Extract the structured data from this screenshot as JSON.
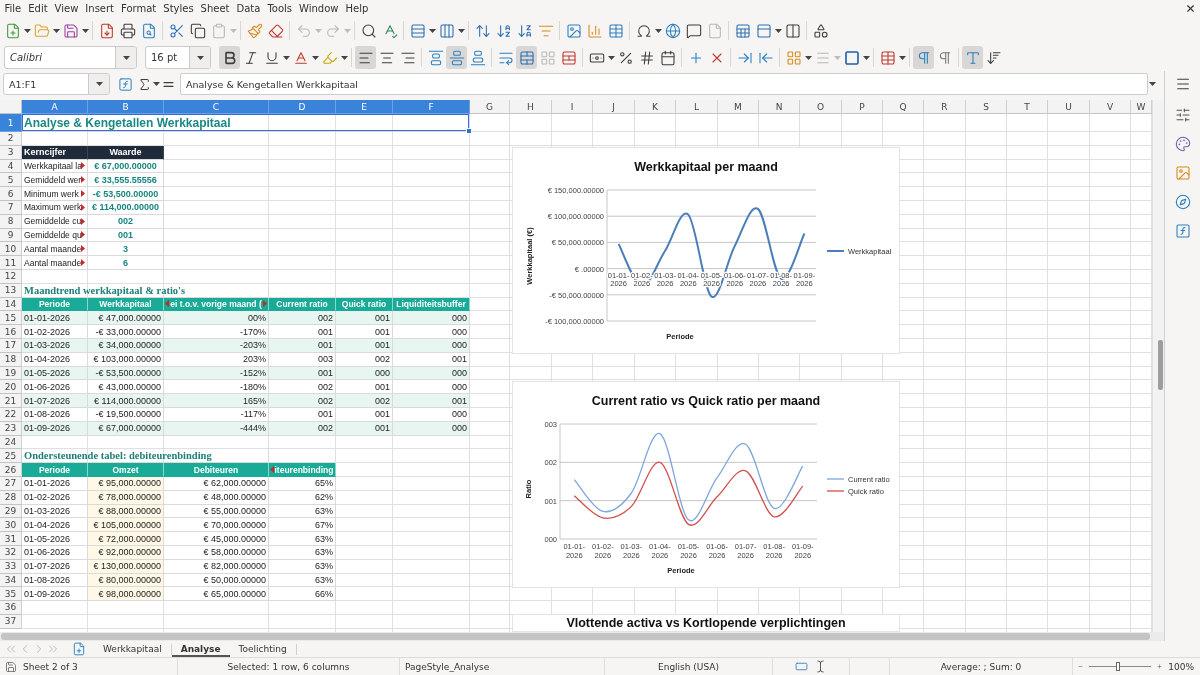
{
  "menu_bar": {
    "items": [
      "File",
      "Edit",
      "View",
      "Insert",
      "Format",
      "Styles",
      "Sheet",
      "Data",
      "Tools",
      "Window",
      "Help"
    ]
  },
  "standard_toolbar": {
    "paste_disabled": true,
    "undo_disabled": true,
    "redo_disabled": true,
    "header_footer_disabled": true
  },
  "formatting_toolbar": {
    "font_name": "Calibri",
    "font_size": "16 pt",
    "bold": true,
    "italic": false,
    "underline": false,
    "align_left": true,
    "align_center": false,
    "align_right": false,
    "align_top": false,
    "align_middle": true,
    "align_bottom": false,
    "merge_and_center": true,
    "merge_cells_disabled": true,
    "border_style_disabled": true,
    "left_to_right": true,
    "right_to_left": false,
    "text_horizontal": true,
    "text_vertical": false
  },
  "formula_bar": {
    "name_box": "A1:F1",
    "content": "Analyse & Kengetallen Werkkapitaal"
  },
  "sheet": {
    "columns": [
      {
        "label": "A",
        "selected": true
      },
      {
        "label": "B",
        "selected": true
      },
      {
        "label": "C",
        "selected": true
      },
      {
        "label": "D",
        "selected": true
      },
      {
        "label": "E",
        "selected": true
      },
      {
        "label": "F",
        "selected": true
      },
      {
        "label": "G",
        "selected": false
      },
      {
        "label": "H",
        "selected": false
      },
      {
        "label": "I",
        "selected": false
      },
      {
        "label": "J",
        "selected": false
      },
      {
        "label": "K",
        "selected": false
      },
      {
        "label": "L",
        "selected": false
      },
      {
        "label": "M",
        "selected": false
      },
      {
        "label": "N",
        "selected": false
      },
      {
        "label": "O",
        "selected": false
      },
      {
        "label": "P",
        "selected": false
      },
      {
        "label": "Q",
        "selected": false
      },
      {
        "label": "R",
        "selected": false
      },
      {
        "label": "S",
        "selected": false
      },
      {
        "label": "T",
        "selected": false
      },
      {
        "label": "U",
        "selected": false
      },
      {
        "label": "V",
        "selected": false
      },
      {
        "label": "W",
        "selected": false
      }
    ],
    "rows": [
      {
        "header": "1",
        "selected": true,
        "banded": false,
        "cells": [
          {
            "kind": "title",
            "text": "Analyse & Kengetallen Werkkapitaal"
          }
        ]
      },
      {
        "header": "2",
        "selected": false
      },
      {
        "header": "3",
        "selected": false,
        "banded": false,
        "cells": [
          {
            "kind": "key-header",
            "text": "Kerncijfer"
          },
          {
            "kind": "value-header",
            "text": "Waarde"
          }
        ]
      },
      {
        "header": "4",
        "selected": false,
        "banded": false,
        "cells": [
          {
            "kind": "label",
            "text": "Werkkapitaal la",
            "clipped_right": true
          },
          {
            "kind": "value",
            "text": "€ 67,000.00000"
          }
        ]
      },
      {
        "header": "5",
        "selected": false,
        "banded": false,
        "cells": [
          {
            "kind": "label",
            "text": "Gemiddeld wer",
            "clipped_right": true
          },
          {
            "kind": "value",
            "text": "€ 33,555.55556"
          }
        ]
      },
      {
        "header": "6",
        "selected": false,
        "banded": false,
        "cells": [
          {
            "kind": "label",
            "text": "Minimum werk",
            "clipped_right": true
          },
          {
            "kind": "value",
            "text": "-€ 53,500.00000"
          }
        ]
      },
      {
        "header": "7",
        "selected": false,
        "banded": false,
        "cells": [
          {
            "kind": "label",
            "text": "Maximum werk",
            "clipped_right": true
          },
          {
            "kind": "value",
            "text": "€ 114,000.00000"
          }
        ]
      },
      {
        "header": "8",
        "selected": false,
        "banded": false,
        "cells": [
          {
            "kind": "label",
            "text": "Gemiddelde cu",
            "clipped_right": true
          },
          {
            "kind": "value",
            "text": "002"
          }
        ]
      },
      {
        "header": "9",
        "selected": false,
        "banded": false,
        "cells": [
          {
            "kind": "label",
            "text": "Gemiddelde qu",
            "clipped_right": true
          },
          {
            "kind": "value",
            "text": "001"
          }
        ]
      },
      {
        "header": "10",
        "selected": false,
        "banded": false,
        "cells": [
          {
            "kind": "label",
            "text": "Aantal maande",
            "clipped_right": true
          },
          {
            "kind": "value",
            "text": "3"
          }
        ]
      },
      {
        "header": "11",
        "selected": false,
        "banded": false,
        "cells": [
          {
            "kind": "label",
            "text": "Aantal maande",
            "clipped_right": true
          },
          {
            "kind": "value",
            "text": "6"
          }
        ]
      },
      {
        "header": "12",
        "selected": false
      },
      {
        "header": "13",
        "selected": false,
        "banded": false,
        "cells": [
          {
            "kind": "section",
            "text": "Maandtrend werkkapitaal & ratio's"
          }
        ]
      },
      {
        "header": "14",
        "selected": false,
        "banded": false,
        "cells": [
          {
            "kind": "header",
            "text": "Periode"
          },
          {
            "kind": "header",
            "text": "Werkkapitaal"
          },
          {
            "kind": "header",
            "text": "ei t.o.v. vorige maand (",
            "clipped_left": true,
            "clipped_right": true
          },
          {
            "kind": "header",
            "text": "Current ratio"
          },
          {
            "kind": "header",
            "text": "Quick ratio"
          },
          {
            "kind": "header",
            "text": "Liquiditeitsbuffer"
          }
        ]
      },
      {
        "header": "15",
        "selected": false,
        "banded": true,
        "cells": [
          {
            "kind": "date",
            "text": "01-01-2026"
          },
          {
            "kind": "number",
            "text": "€ 47,000.00000"
          },
          {
            "kind": "number",
            "text": "00%"
          },
          {
            "kind": "number",
            "text": "002"
          },
          {
            "kind": "number",
            "text": "001"
          },
          {
            "kind": "number",
            "text": "000"
          }
        ]
      },
      {
        "header": "16",
        "selected": false,
        "banded": false,
        "cells": [
          {
            "kind": "date",
            "text": "01-02-2026"
          },
          {
            "kind": "number",
            "text": "-€ 33,000.00000"
          },
          {
            "kind": "number",
            "text": "-170%"
          },
          {
            "kind": "number",
            "text": "001"
          },
          {
            "kind": "number",
            "text": "001"
          },
          {
            "kind": "number",
            "text": "000"
          }
        ]
      },
      {
        "header": "17",
        "selected": false,
        "banded": true,
        "cells": [
          {
            "kind": "date",
            "text": "01-03-2026"
          },
          {
            "kind": "number",
            "text": "€ 34,000.00000"
          },
          {
            "kind": "number",
            "text": "-203%"
          },
          {
            "kind": "number",
            "text": "001"
          },
          {
            "kind": "number",
            "text": "001"
          },
          {
            "kind": "number",
            "text": "000"
          }
        ]
      },
      {
        "header": "18",
        "selected": false,
        "banded": false,
        "cells": [
          {
            "kind": "date",
            "text": "01-04-2026"
          },
          {
            "kind": "number",
            "text": "€ 103,000.00000"
          },
          {
            "kind": "number",
            "text": "203%"
          },
          {
            "kind": "number",
            "text": "003"
          },
          {
            "kind": "number",
            "text": "002"
          },
          {
            "kind": "number",
            "text": "001"
          }
        ]
      },
      {
        "header": "19",
        "selected": false,
        "banded": true,
        "cells": [
          {
            "kind": "date",
            "text": "01-05-2026"
          },
          {
            "kind": "number",
            "text": "-€ 53,500.00000"
          },
          {
            "kind": "number",
            "text": "-152%"
          },
          {
            "kind": "number",
            "text": "001"
          },
          {
            "kind": "number",
            "text": "000"
          },
          {
            "kind": "number",
            "text": "000"
          }
        ]
      },
      {
        "header": "20",
        "selected": false,
        "banded": false,
        "cells": [
          {
            "kind": "date",
            "text": "01-06-2026"
          },
          {
            "kind": "number",
            "text": "€ 43,000.00000"
          },
          {
            "kind": "number",
            "text": "-180%"
          },
          {
            "kind": "number",
            "text": "002"
          },
          {
            "kind": "number",
            "text": "001"
          },
          {
            "kind": "number",
            "text": "000"
          }
        ]
      },
      {
        "header": "21",
        "selected": false,
        "banded": true,
        "cells": [
          {
            "kind": "date",
            "text": "01-07-2026"
          },
          {
            "kind": "number",
            "text": "€ 114,000.00000"
          },
          {
            "kind": "number",
            "text": "165%"
          },
          {
            "kind": "number",
            "text": "002"
          },
          {
            "kind": "number",
            "text": "002"
          },
          {
            "kind": "number",
            "text": "001"
          }
        ]
      },
      {
        "header": "22",
        "selected": false,
        "banded": false,
        "cells": [
          {
            "kind": "date",
            "text": "01-08-2026"
          },
          {
            "kind": "number",
            "text": "-€ 19,500.00000"
          },
          {
            "kind": "number",
            "text": "-117%"
          },
          {
            "kind": "number",
            "text": "001"
          },
          {
            "kind": "number",
            "text": "001"
          },
          {
            "kind": "number",
            "text": "000"
          }
        ]
      },
      {
        "header": "23",
        "selected": false,
        "banded": true,
        "cells": [
          {
            "kind": "date",
            "text": "01-09-2026"
          },
          {
            "kind": "number",
            "text": "€ 67,000.00000"
          },
          {
            "kind": "number",
            "text": "-444%"
          },
          {
            "kind": "number",
            "text": "002"
          },
          {
            "kind": "number",
            "text": "001"
          },
          {
            "kind": "number",
            "text": "000"
          }
        ]
      },
      {
        "header": "24",
        "selected": false
      },
      {
        "header": "25",
        "selected": false,
        "banded": false,
        "cells": [
          {
            "kind": "section",
            "text": "Ondersteunende tabel: debiteurenbinding"
          }
        ]
      },
      {
        "header": "26",
        "selected": false,
        "banded": false,
        "cells": [
          {
            "kind": "header",
            "text": "Periode"
          },
          {
            "kind": "header",
            "text": "Omzet"
          },
          {
            "kind": "header",
            "text": "Debiteuren"
          },
          {
            "kind": "header",
            "text": "iteurenbinding",
            "clipped_left": true
          }
        ]
      },
      {
        "header": "27",
        "selected": false,
        "banded": false,
        "cells": [
          {
            "kind": "date",
            "text": "01-01-2026"
          },
          {
            "kind": "number-shaded",
            "text": "€ 95,000.00000"
          },
          {
            "kind": "number",
            "text": "€ 62,000.00000"
          },
          {
            "kind": "number",
            "text": "65%"
          }
        ]
      },
      {
        "header": "28",
        "selected": false,
        "banded": false,
        "cells": [
          {
            "kind": "date",
            "text": "01-02-2026"
          },
          {
            "kind": "number-shaded",
            "text": "€ 78,000.00000"
          },
          {
            "kind": "number",
            "text": "€ 48,000.00000"
          },
          {
            "kind": "number",
            "text": "62%"
          }
        ]
      },
      {
        "header": "29",
        "selected": false,
        "banded": false,
        "cells": [
          {
            "kind": "date",
            "text": "01-03-2026"
          },
          {
            "kind": "number-shaded",
            "text": "€ 88,000.00000"
          },
          {
            "kind": "number",
            "text": "€ 55,000.00000"
          },
          {
            "kind": "number",
            "text": "63%"
          }
        ]
      },
      {
        "header": "30",
        "selected": false,
        "banded": false,
        "cells": [
          {
            "kind": "date",
            "text": "01-04-2026"
          },
          {
            "kind": "number-shaded",
            "text": "€ 105,000.00000"
          },
          {
            "kind": "number",
            "text": "€ 70,000.00000"
          },
          {
            "kind": "number",
            "text": "67%"
          }
        ]
      },
      {
        "header": "31",
        "selected": false,
        "banded": false,
        "cells": [
          {
            "kind": "date",
            "text": "01-05-2026"
          },
          {
            "kind": "number-shaded",
            "text": "€ 72,000.00000"
          },
          {
            "kind": "number",
            "text": "€ 45,000.00000"
          },
          {
            "kind": "number",
            "text": "63%"
          }
        ]
      },
      {
        "header": "32",
        "selected": false,
        "banded": false,
        "cells": [
          {
            "kind": "date",
            "text": "01-06-2026"
          },
          {
            "kind": "number-shaded",
            "text": "€ 92,000.00000"
          },
          {
            "kind": "number",
            "text": "€ 58,000.00000"
          },
          {
            "kind": "number",
            "text": "63%"
          }
        ]
      },
      {
        "header": "33",
        "selected": false,
        "banded": false,
        "cells": [
          {
            "kind": "date",
            "text": "01-07-2026"
          },
          {
            "kind": "number-shaded",
            "text": "€ 130,000.00000"
          },
          {
            "kind": "number",
            "text": "€ 82,000.00000"
          },
          {
            "kind": "number",
            "text": "63%"
          }
        ]
      },
      {
        "header": "34",
        "selected": false,
        "banded": false,
        "cells": [
          {
            "kind": "date",
            "text": "01-08-2026"
          },
          {
            "kind": "number-shaded",
            "text": "€ 80,000.00000"
          },
          {
            "kind": "number",
            "text": "€ 50,000.00000"
          },
          {
            "kind": "number",
            "text": "63%"
          }
        ]
      },
      {
        "header": "35",
        "selected": false,
        "banded": false,
        "cells": [
          {
            "kind": "date",
            "text": "01-09-2026"
          },
          {
            "kind": "number-shaded",
            "text": "€ 98,000.00000"
          },
          {
            "kind": "number",
            "text": "€ 65,000.00000"
          },
          {
            "kind": "number",
            "text": "66%"
          }
        ]
      },
      {
        "header": "36",
        "selected": false
      },
      {
        "header": "37",
        "selected": false
      }
    ]
  },
  "charts": [
    {
      "chart_data": {
        "type": "line",
        "title": "Werkkapitaal per maand",
        "xlabel": "Periode",
        "ylabel": "Werkkapitaal (€)",
        "categories": [
          "01-01-2026",
          "01-02-2026",
          "01-03-2026",
          "01-04-2026",
          "01-05-2026",
          "01-06-2026",
          "01-07-2026",
          "01-08-2026",
          "01-09-2026"
        ],
        "series": [
          {
            "name": "Werkkapitaal",
            "color": "#4a7ebb",
            "values": [
              47000,
              -33000,
              34000,
              103000,
              -53500,
              43000,
              114000,
              -19500,
              67000
            ]
          }
        ],
        "ylim": [
          -100000,
          150000
        ],
        "yticks": [
          {
            "value": -100000,
            "label": "-€ 100,000.00000"
          },
          {
            "value": -50000,
            "label": "-€ 50,000.00000"
          },
          {
            "value": 0,
            "label": "€ .00000"
          },
          {
            "value": 50000,
            "label": "€ 50,000.00000"
          },
          {
            "value": 100000,
            "label": "€ 100,000.00000"
          },
          {
            "value": 150000,
            "label": "€ 150,000.00000"
          }
        ],
        "grid": true,
        "legend": "right"
      }
    },
    {
      "chart_data": {
        "type": "line",
        "title": "Current ratio vs Quick ratio per maand",
        "xlabel": "Periode",
        "ylabel": "Ratio",
        "categories": [
          "01-01-2026",
          "01-02-2026",
          "01-03-2026",
          "01-04-2026",
          "01-05-2026",
          "01-06-2026",
          "01-07-2026",
          "01-08-2026",
          "01-09-2026"
        ],
        "series": [
          {
            "name": "Current ratio",
            "color": "#7ba6dc",
            "values": [
              1.55,
              0.72,
              1.2,
              2.75,
              0.5,
              1.6,
              2.47,
              0.8,
              1.9
            ]
          },
          {
            "name": "Quick ratio",
            "color": "#d0504e",
            "values": [
              1.13,
              0.55,
              0.85,
              2.0,
              0.38,
              1.1,
              1.78,
              0.58,
              1.38
            ]
          }
        ],
        "ylim": [
          0,
          3
        ],
        "yticks": [
          {
            "value": 0,
            "label": "000"
          },
          {
            "value": 1,
            "label": "001"
          },
          {
            "value": 2,
            "label": "002"
          },
          {
            "value": 3,
            "label": "003"
          }
        ],
        "grid": true,
        "legend": "right"
      }
    },
    {
      "title": "Vlottende activa vs Kortlopende verplichtingen"
    }
  ],
  "sheet_tabs": {
    "navigation_disabled": true,
    "tabs": [
      {
        "label": "Werkkapitaal",
        "selected": false
      },
      {
        "label": "Analyse",
        "selected": true
      },
      {
        "label": "Toelichting",
        "selected": false
      }
    ]
  },
  "status_bar": {
    "sheet_position": "Sheet 2 of 3",
    "selection": "Selected: 1 row, 6 columns",
    "page_style": "PageStyle_Analyse",
    "language": "English (USA)",
    "summary": "Average: ; Sum: 0",
    "zoom_slider": {
      "level": 0.46
    },
    "zoom": "100%"
  }
}
